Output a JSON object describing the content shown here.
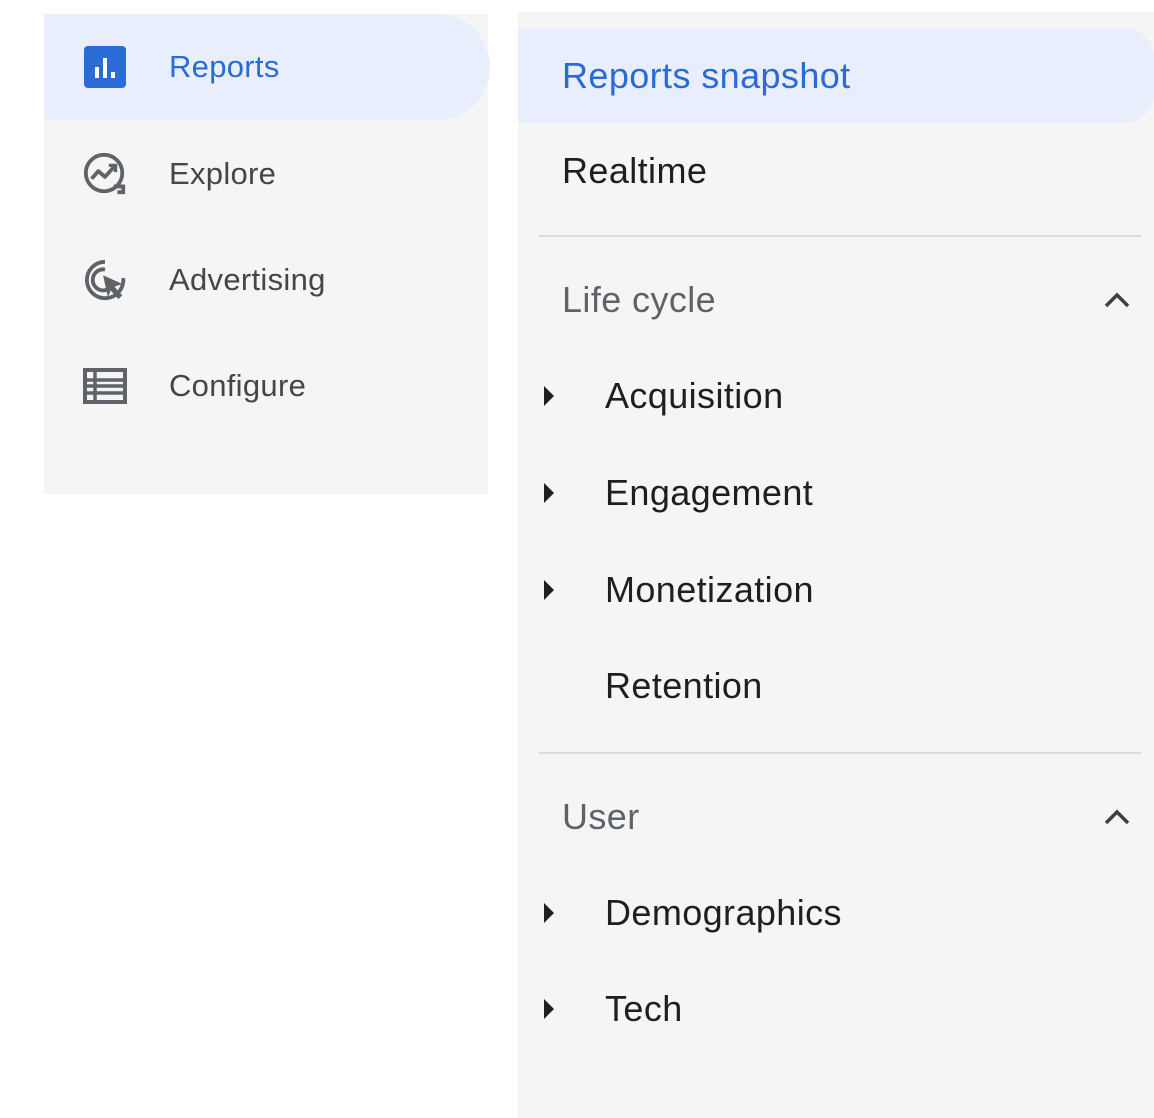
{
  "left_nav": {
    "items": [
      {
        "label": "Reports",
        "icon": "bar-chart-icon",
        "active": true
      },
      {
        "label": "Explore",
        "icon": "explore-trend-icon",
        "active": false
      },
      {
        "label": "Advertising",
        "icon": "ad-cursor-icon",
        "active": false
      },
      {
        "label": "Configure",
        "icon": "list-table-icon",
        "active": false
      }
    ]
  },
  "report_nav": {
    "snapshot_label": "Reports snapshot",
    "realtime_label": "Realtime",
    "sections": [
      {
        "title": "Life cycle",
        "expanded": true,
        "items": [
          {
            "label": "Acquisition",
            "has_children": true
          },
          {
            "label": "Engagement",
            "has_children": true
          },
          {
            "label": "Monetization",
            "has_children": true
          },
          {
            "label": "Retention",
            "has_children": false
          }
        ]
      },
      {
        "title": "User",
        "expanded": true,
        "items": [
          {
            "label": "Demographics",
            "has_children": true
          },
          {
            "label": "Tech",
            "has_children": true
          }
        ]
      }
    ]
  },
  "colors": {
    "accent": "#2a6bd6",
    "active_bg": "#e8eefb",
    "panel_bg": "#f5f5f5",
    "text_primary": "#1f1f1f",
    "text_secondary": "#5f6368",
    "icon_gray": "#5f6368",
    "divider": "#dadce0"
  }
}
